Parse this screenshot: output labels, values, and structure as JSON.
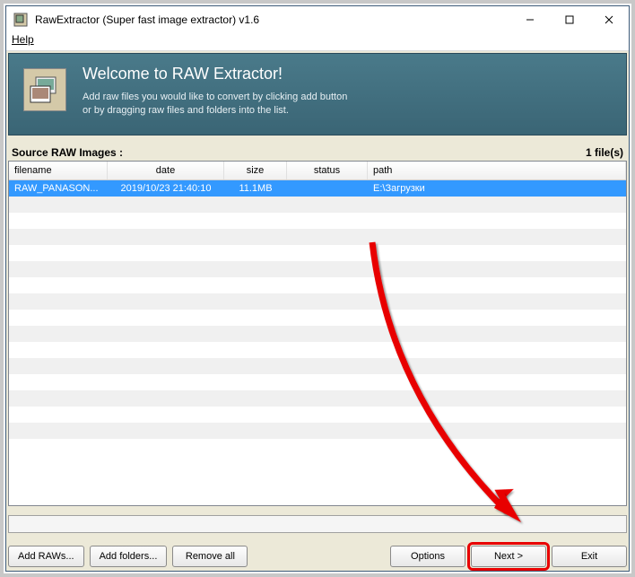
{
  "window": {
    "title": "RawExtractor (Super fast image extractor) v1.6"
  },
  "menubar": {
    "help": "Help"
  },
  "banner": {
    "heading": "Welcome to RAW Extractor!",
    "sub1": "Add raw files you would like to convert by clicking add button",
    "sub2": "or by dragging raw files and folders into the list."
  },
  "list": {
    "title": "Source RAW Images :",
    "count": "1 file(s)",
    "columns": {
      "filename": "filename",
      "date": "date",
      "size": "size",
      "status": "status",
      "path": "path"
    },
    "rows": [
      {
        "filename": "RAW_PANASON...",
        "date": "2019/10/23 21:40:10",
        "size": "11.1MB",
        "status": "",
        "path": "E:\\Загрузки"
      }
    ]
  },
  "buttons": {
    "add_raws": "Add RAWs...",
    "add_folders": "Add folders...",
    "remove_all": "Remove all",
    "options": "Options",
    "next": "Next >",
    "exit": "Exit"
  }
}
